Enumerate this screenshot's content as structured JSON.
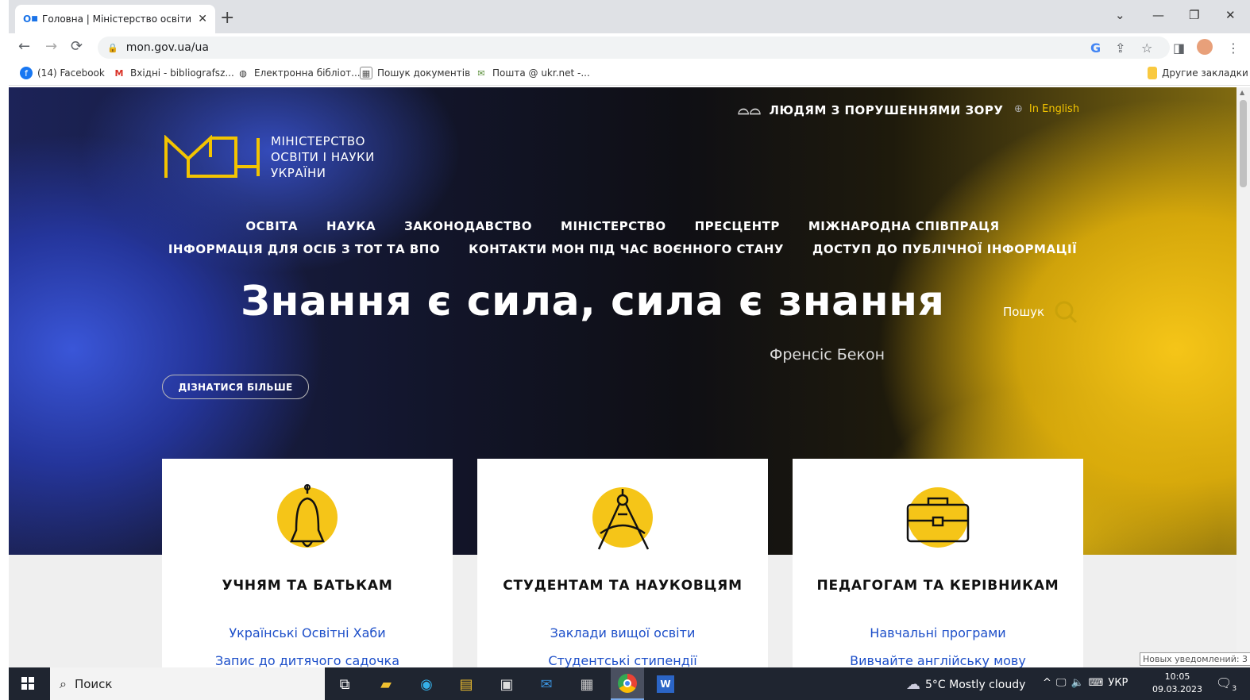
{
  "browser": {
    "tab_title": "Головна | Міністерство освіти і…",
    "tab_close": "✕",
    "new_tab": "+",
    "url": "mon.gov.ua/ua",
    "bookmarks": [
      {
        "label": "(14) Facebook",
        "icon": "facebook-icon"
      },
      {
        "label": "Вхідні - bibliografsz...",
        "icon": "gmail-icon"
      },
      {
        "label": "Електронна бібліот...",
        "icon": "globe-icon"
      },
      {
        "label": "Пошук документів",
        "icon": "image-icon"
      },
      {
        "label": "Пошта @ ukr.net -...",
        "icon": "mail-icon"
      }
    ],
    "other_bookmarks": "Другие закладки"
  },
  "site": {
    "accessibility": "ЛЮДЯМ З ПОРУШЕННЯМИ ЗОРУ",
    "english": "In English",
    "logo_lines": [
      "МІНІСТЕРСТВО",
      "ОСВІТИ І НАУКИ",
      "УКРАЇНИ"
    ],
    "menu_row1": [
      "ОСВІТА",
      "НАУКА",
      "ЗАКОНОДАВСТВО",
      "МІНІСТЕРСТВО",
      "ПРЕСЦЕНТР",
      "МІЖНАРОДНА СПІВПРАЦЯ"
    ],
    "menu_row2": [
      "ІНФОРМАЦІЯ ДЛЯ ОСІБ З ТОТ ТА ВПО",
      "КОНТАКТИ МОН ПІД ЧАС ВОЄННОГО СТАНУ",
      "ДОСТУП ДО ПУБЛІЧНОЇ ІНФОРМАЦІЇ"
    ],
    "quote": "Знання є сила, сила є знання",
    "author": "Френсіс Бекон",
    "search_label": "Пошук",
    "more_button": "ДІЗНАТИСЯ БІЛЬШЕ",
    "cards": [
      {
        "title": "УЧНЯМ ТА БАТЬКАМ",
        "links": [
          "Українські Освітні Хаби",
          "Запис до дитячого садочка"
        ],
        "icon": "bell-icon"
      },
      {
        "title": "СТУДЕНТАМ ТА НАУКОВЦЯМ",
        "links": [
          "Заклади вищої освіти",
          "Студентські стипендії"
        ],
        "icon": "compass-icon"
      },
      {
        "title": "ПЕДАГОГАМ ТА КЕРІВНИКАМ",
        "links": [
          "Навчальні програми",
          "Вивчайте англійську мову"
        ],
        "icon": "briefcase-icon"
      }
    ]
  },
  "notification_tooltip": "Новых уведомлений: 3",
  "taskbar": {
    "search": "Поиск",
    "weather": "5°C  Mostly cloudy",
    "lang": "УКР",
    "time": "10:05",
    "date": "09.03.2023",
    "notif_count": "3"
  },
  "colors": {
    "accent_yellow": "#f5c518",
    "link_blue": "#1d4fc9",
    "hero_blue": "#3a56d8"
  }
}
